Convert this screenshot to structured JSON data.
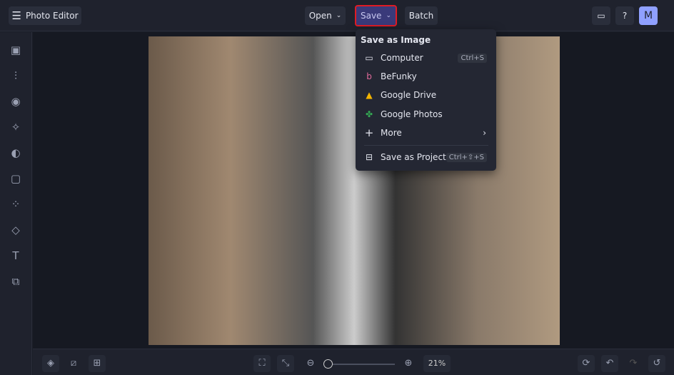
{
  "header": {
    "app_title": "Photo Editor",
    "open_label": "Open",
    "save_label": "Save",
    "batch_label": "Batch",
    "avatar_initial": "M"
  },
  "save_menu": {
    "heading": "Save as Image",
    "items": [
      {
        "label": "Computer",
        "shortcut": "Ctrl+S",
        "icon": "monitor-icon"
      },
      {
        "label": "BeFunky",
        "icon": "befunky-icon"
      },
      {
        "label": "Google Drive",
        "icon": "google-drive-icon"
      },
      {
        "label": "Google Photos",
        "icon": "google-photos-icon"
      },
      {
        "label": "More",
        "icon": "plus-icon"
      },
      {
        "label": "Save as Project",
        "shortcut": "Ctrl+⇧+S",
        "icon": "briefcase-icon"
      }
    ]
  },
  "bottom": {
    "zoom_percent": "21%",
    "zoom_value": 21
  },
  "colors": {
    "accent": "#3a3a7a",
    "highlight": "#e01b24"
  }
}
